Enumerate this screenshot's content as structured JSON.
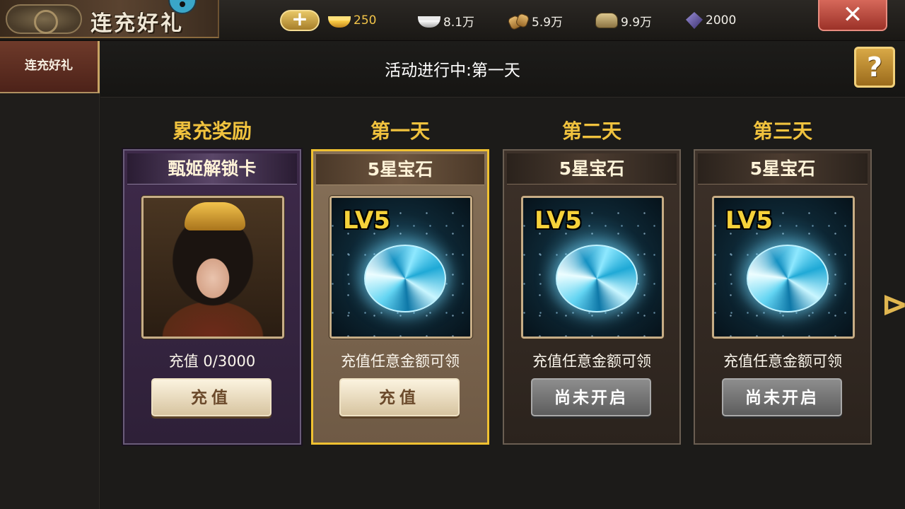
{
  "header": {
    "title": "连充好礼",
    "add_label": "+",
    "resources": [
      {
        "icon": "gold-ingot-icon",
        "value": "250"
      },
      {
        "icon": "silver-ingot-icon",
        "value": "8.1万"
      },
      {
        "icon": "grain-icon",
        "value": "5.9万"
      },
      {
        "icon": "money-bag-icon",
        "value": "9.9万"
      },
      {
        "icon": "crystal-icon",
        "value": "2000"
      }
    ],
    "close_label": "✕"
  },
  "sidebar": {
    "items": [
      {
        "label": "连充好礼",
        "active": true
      }
    ]
  },
  "status": {
    "text": "活动进行中:第一天",
    "help_label": "?"
  },
  "columns": [
    {
      "heading": "累充奖励",
      "style": "purple",
      "item_name": "甄姬解锁卡",
      "item_image": "hero-portrait",
      "desc": "充值 0/3000",
      "button": "充值",
      "button_state": "active"
    },
    {
      "heading": "第一天",
      "style": "selected",
      "item_name": "5星宝石",
      "item_image": "gem",
      "item_badge": "LV5",
      "desc": "充值任意金额可领",
      "button": "充值",
      "button_state": "active"
    },
    {
      "heading": "第二天",
      "style": "locked",
      "item_name": "5星宝石",
      "item_image": "gem",
      "item_badge": "LV5",
      "desc": "充值任意金额可领",
      "button": "尚未开启",
      "button_state": "disabled"
    },
    {
      "heading": "第三天",
      "style": "locked",
      "item_name": "5星宝石",
      "item_image": "gem",
      "item_badge": "LV5",
      "desc": "充值任意金额可领",
      "button": "尚未开启",
      "button_state": "disabled"
    }
  ],
  "colors": {
    "heading_gold": "#f0c23e",
    "selected_border": "#f0c131",
    "close_red": "#c14a3c"
  }
}
